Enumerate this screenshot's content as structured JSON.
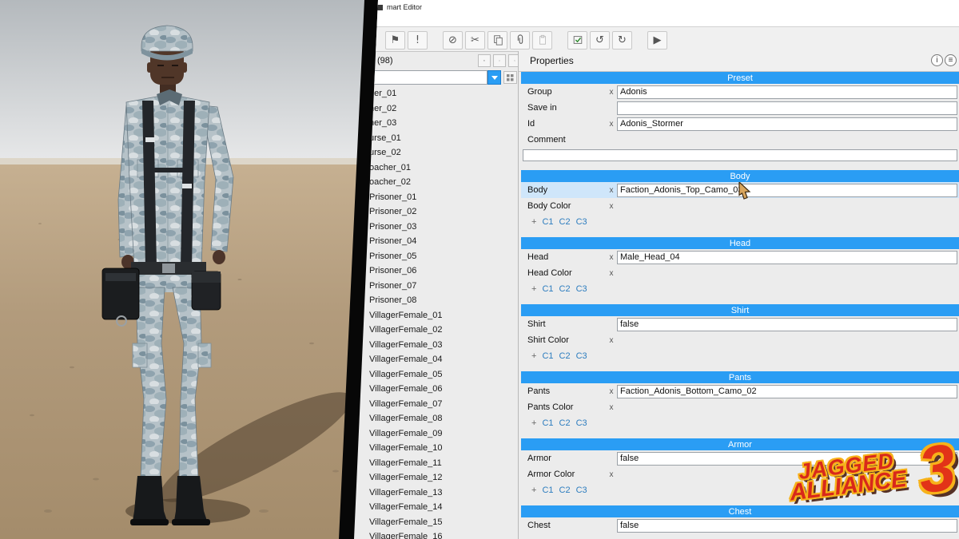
{
  "window": {
    "title": "mart Editor"
  },
  "toolbar": {
    "buttons": [
      {
        "name": "bookmark",
        "glyph": "⚑"
      },
      {
        "name": "warning",
        "glyph": "!"
      },
      {
        "name": "separator"
      },
      {
        "name": "forbidden",
        "glyph": "⊘"
      },
      {
        "name": "cut",
        "glyph": "✂"
      },
      {
        "name": "copy"
      },
      {
        "name": "paperclip"
      },
      {
        "name": "paste"
      },
      {
        "name": "separator"
      },
      {
        "name": "apply"
      },
      {
        "name": "undo",
        "glyph": "↺"
      },
      {
        "name": "redo",
        "glyph": "↻"
      },
      {
        "name": "separator"
      },
      {
        "name": "play",
        "glyph": "▶"
      }
    ]
  },
  "browser": {
    "header": "(98)",
    "filter_value": "",
    "items": [
      "ner_01",
      "ner_02",
      "ner_03",
      "urse_01",
      "urse_02",
      "oacher_01",
      "oacher_02",
      "Prisoner_01",
      "Prisoner_02",
      "Prisoner_03",
      "Prisoner_04",
      "Prisoner_05",
      "Prisoner_06",
      "Prisoner_07",
      "Prisoner_08",
      "VillagerFemale_01",
      "VillagerFemale_02",
      "VillagerFemale_03",
      "VillagerFemale_04",
      "VillagerFemale_05",
      "VillagerFemale_06",
      "VillagerFemale_07",
      "VillagerFemale_08",
      "VillagerFemale_09",
      "VillagerFemale_10",
      "VillagerFemale_11",
      "VillagerFemale_12",
      "VillagerFemale_13",
      "VillagerFemale_14",
      "VillagerFemale_15",
      "VillagerFemale_16"
    ]
  },
  "properties": {
    "title": "Properties",
    "clear_glyph": "x",
    "sections": [
      {
        "title": "Preset",
        "rows": [
          {
            "label": "Group",
            "clear": true,
            "field": "Adonis"
          },
          {
            "label": "Save in",
            "clear": false,
            "field": ""
          },
          {
            "label": "Id",
            "clear": true,
            "field": "Adonis_Stormer"
          },
          {
            "label": "Comment",
            "clear": false,
            "field": null,
            "wide_field": ""
          }
        ]
      },
      {
        "title": "Body",
        "rows": [
          {
            "label": "Body",
            "clear": true,
            "field": "Faction_Adonis_Top_Camo_03",
            "highlight": true
          },
          {
            "label": "Body Color",
            "clear": true,
            "field": null
          },
          {
            "plus": "+",
            "links": [
              "C1",
              "C2",
              "C3"
            ]
          }
        ]
      },
      {
        "title": "Head",
        "rows": [
          {
            "label": "Head",
            "clear": true,
            "field": "Male_Head_04"
          },
          {
            "label": "Head Color",
            "clear": true,
            "field": null
          },
          {
            "plus": "+",
            "links": [
              "C1",
              "C2",
              "C3"
            ]
          }
        ]
      },
      {
        "title": "Shirt",
        "rows": [
          {
            "label": "Shirt",
            "clear": false,
            "field": "false"
          },
          {
            "label": "Shirt Color",
            "clear": true,
            "field": null
          },
          {
            "plus": "+",
            "links": [
              "C1",
              "C2",
              "C3"
            ]
          }
        ]
      },
      {
        "title": "Pants",
        "rows": [
          {
            "label": "Pants",
            "clear": true,
            "field": "Faction_Adonis_Bottom_Camo_02"
          },
          {
            "label": "Pants Color",
            "clear": true,
            "field": null
          },
          {
            "plus": "+",
            "links": [
              "C1",
              "C2",
              "C3"
            ]
          }
        ]
      },
      {
        "title": "Armor",
        "rows": [
          {
            "label": "Armor",
            "clear": false,
            "field": "false"
          },
          {
            "label": "Armor Color",
            "clear": true,
            "field": null
          },
          {
            "plus": "+",
            "links": [
              "C1",
              "C2",
              "C3"
            ]
          }
        ]
      },
      {
        "title": "Chest",
        "rows": [
          {
            "label": "Chest",
            "clear": false,
            "field": "false"
          }
        ]
      }
    ]
  },
  "logo": {
    "top": "JAGGED",
    "bottom": "ALLIANCE",
    "number": "3"
  },
  "colors": {
    "accent_blue": "#2a9df4",
    "highlight_row": "#cfe6fa",
    "logo_red": "#d8291b",
    "logo_yellow": "#f7b21a"
  }
}
